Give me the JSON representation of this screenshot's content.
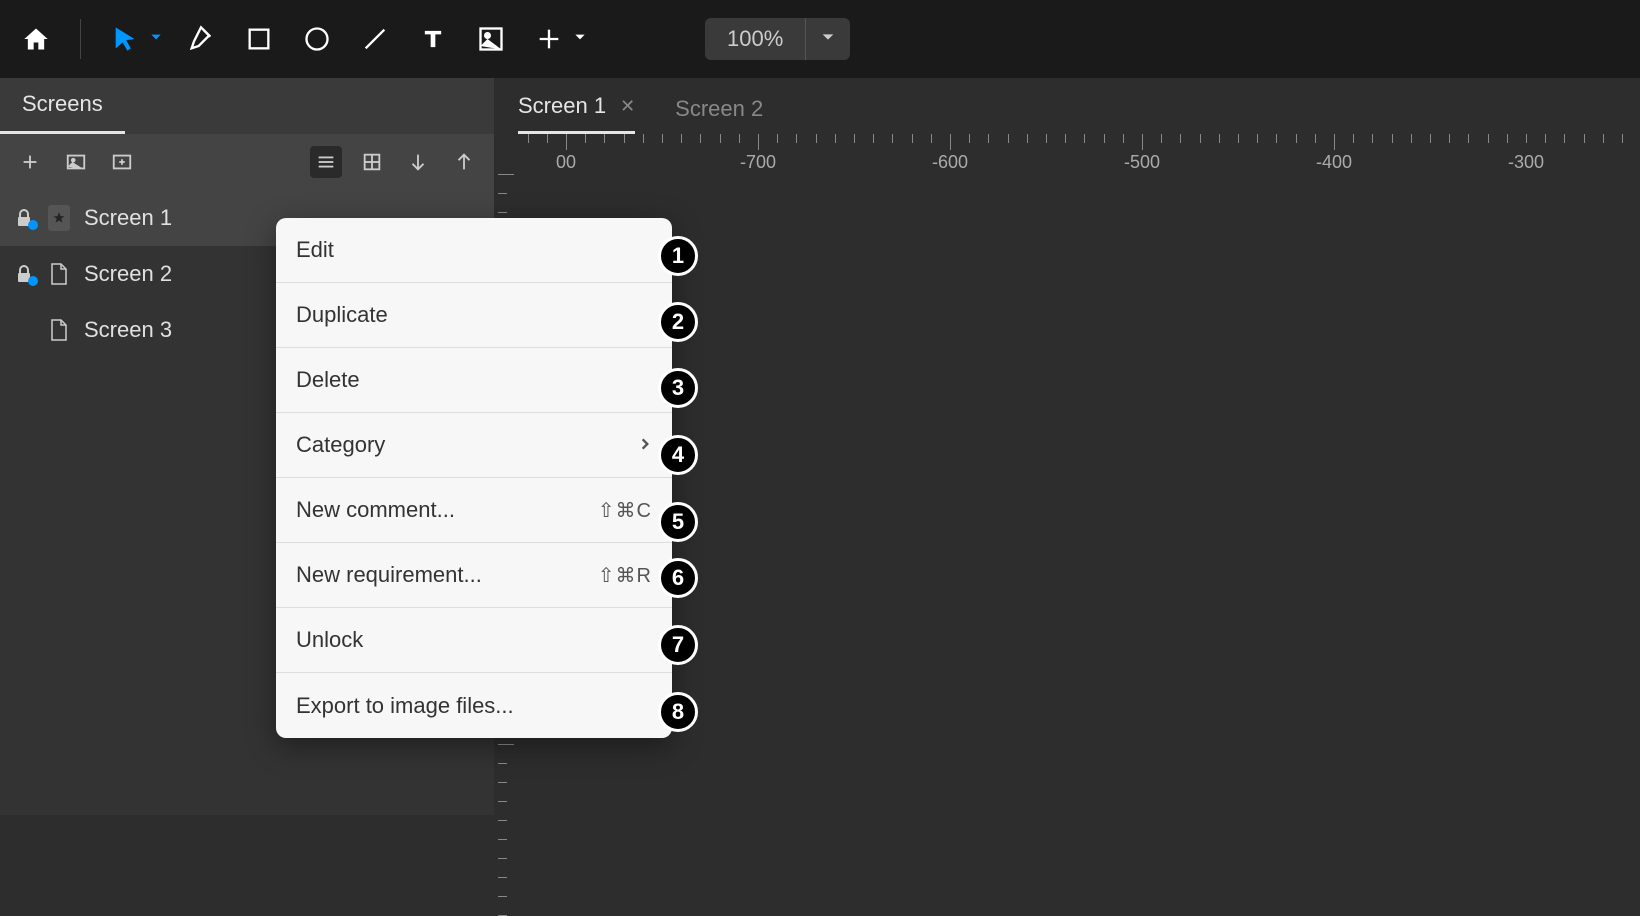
{
  "toolbar": {
    "zoom": "100%"
  },
  "sidebar": {
    "tab": "Screens",
    "screens": [
      {
        "name": "Screen 1",
        "locked": true,
        "starred": true,
        "selected": true
      },
      {
        "name": "Screen 2",
        "locked": true,
        "starred": false,
        "selected": false
      },
      {
        "name": "Screen 3",
        "locked": false,
        "starred": false,
        "selected": false
      }
    ]
  },
  "canvas": {
    "tabs": [
      {
        "name": "Screen 1",
        "active": true
      },
      {
        "name": "Screen 2",
        "active": false
      }
    ],
    "ruler_labels": [
      "00",
      "-700",
      "-600",
      "-500",
      "-400",
      "-300"
    ]
  },
  "context_menu": {
    "items": [
      {
        "label": "Edit",
        "shortcut": "",
        "arrow": false
      },
      {
        "label": "Duplicate",
        "shortcut": "",
        "arrow": false
      },
      {
        "label": "Delete",
        "shortcut": "",
        "arrow": false
      },
      {
        "label": "Category",
        "shortcut": "",
        "arrow": true
      },
      {
        "label": "New comment...",
        "shortcut": "⇧⌘C",
        "arrow": false
      },
      {
        "label": "New requirement...",
        "shortcut": "⇧⌘R",
        "arrow": false
      },
      {
        "label": "Unlock",
        "shortcut": "",
        "arrow": false
      },
      {
        "label": "Export to image files...",
        "shortcut": "",
        "arrow": false
      }
    ]
  },
  "badges": [
    "1",
    "2",
    "3",
    "4",
    "5",
    "6",
    "7",
    "8"
  ]
}
